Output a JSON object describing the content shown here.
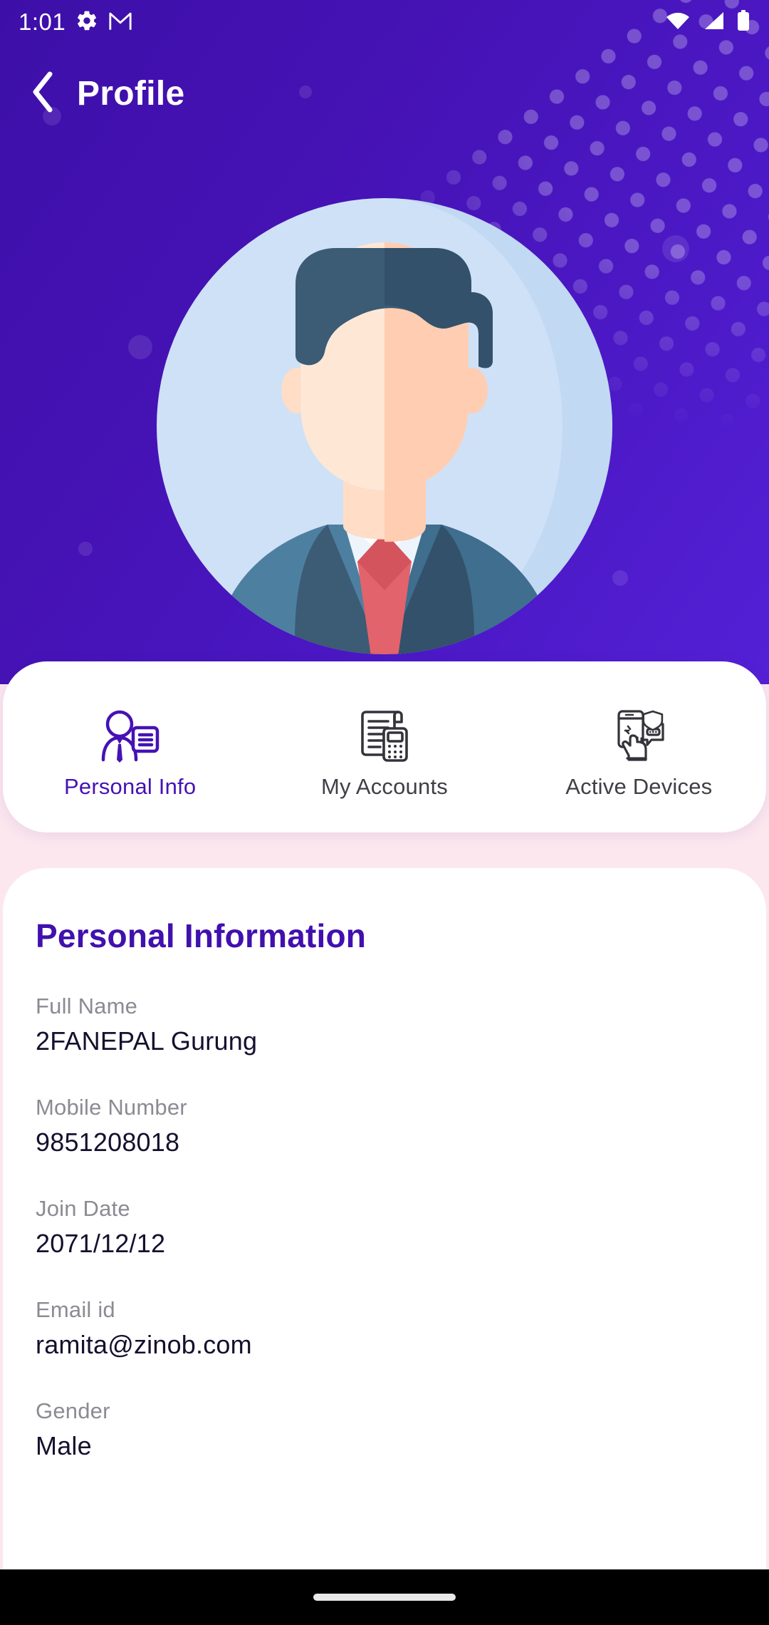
{
  "status_bar": {
    "time": "1:01",
    "left_icons": [
      "gear-icon",
      "gmail-icon"
    ],
    "right_icons": [
      "wifi-icon",
      "cellular-signal-icon",
      "battery-icon"
    ]
  },
  "app_bar": {
    "back_icon": "chevron-left-icon",
    "title": "Profile"
  },
  "avatar": {
    "icon_name": "user-avatar-illustration",
    "alt": "Illustration of a man in a dark blue suit with a red tie"
  },
  "tabs": [
    {
      "label": "Personal Info",
      "icon": "person-id-card-icon",
      "active": true
    },
    {
      "label": "My Accounts",
      "icon": "statement-calculator-icon",
      "active": false
    },
    {
      "label": "Active Devices",
      "icon": "phone-tap-security-icon",
      "active": false
    }
  ],
  "personal_information": {
    "title": "Personal Information",
    "fields": [
      {
        "label": "Full Name",
        "value": "2FANEPAL  Gurung"
      },
      {
        "label": "Mobile Number",
        "value": "9851208018"
      },
      {
        "label": "Join Date",
        "value": "2071/12/12"
      },
      {
        "label": "Email id",
        "value": "ramita@zinob.com"
      },
      {
        "label": "Gender",
        "value": "Male"
      }
    ]
  },
  "nav_bar": {
    "gesture_pill": "home-gesture-pill"
  },
  "colors": {
    "brand_purple": "#4411b0",
    "brand_purple_light": "#5420d6",
    "accent_text": "#4110ae",
    "label_gray": "#8b8b93",
    "value_dark": "#14102e",
    "card_white": "#ffffff",
    "page_pink": "#fce7ef",
    "tie_red": "#e2636c",
    "suit_blue": "#3c5b74",
    "avatar_circle": "#cfe1f7"
  }
}
